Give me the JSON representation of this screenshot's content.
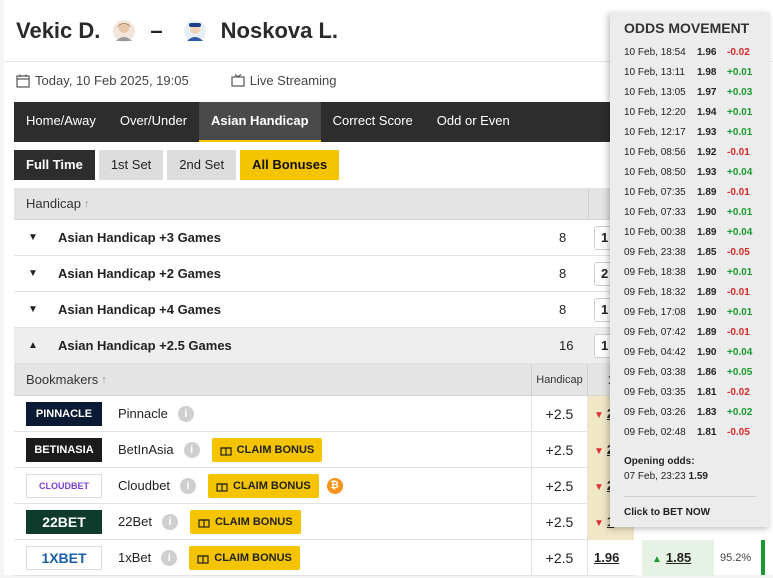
{
  "match": {
    "home": "Vekic D.",
    "separator": "–",
    "away": "Noskova L.",
    "date": "Today, 10 Feb 2025, 19:05",
    "streaming": "Live Streaming"
  },
  "market_tabs": [
    "Home/Away",
    "Over/Under",
    "Asian Handicap",
    "Correct Score",
    "Odd or Even"
  ],
  "market_tab_active": "Asian Handicap",
  "period_tabs": [
    "Full Time",
    "1st Set",
    "2nd Set",
    "All Bonuses"
  ],
  "handicap_table": {
    "header_label": "Handicap",
    "sort_icon": "arrow-up-icon",
    "col1": "1",
    "rows": [
      {
        "label": "Asian Handicap +3 Games",
        "count": "8",
        "odd": "1"
      },
      {
        "label": "Asian Handicap +2 Games",
        "count": "8",
        "odd": "2"
      },
      {
        "label": "Asian Handicap +4 Games",
        "count": "8",
        "odd": "1"
      },
      {
        "label": "Asian Handicap +2.5 Games",
        "count": "16",
        "odd": "1"
      }
    ]
  },
  "bookmakers_table": {
    "header_label": "Bookmakers",
    "handicap_label": "Handicap",
    "col1": "1",
    "claim_label": "CLAIM BONUS",
    "rows": [
      {
        "logo": "PINNACLE",
        "name": "Pinnacle",
        "handicap": "+2.5",
        "odd": "2",
        "bonus": false
      },
      {
        "logo": "BETINASIA",
        "name": "BetInAsia",
        "handicap": "+2.5",
        "odd": "2",
        "bonus": true
      },
      {
        "logo": "CLOUDBET",
        "name": "Cloudbet",
        "handicap": "+2.5",
        "odd": "2",
        "bonus": true
      },
      {
        "logo": "22BET",
        "name": "22Bet",
        "handicap": "+2.5",
        "odd": "1",
        "bonus": true
      },
      {
        "logo": "1XBET",
        "name": "1xBet",
        "handicap": "+2.5",
        "odd": "1.96",
        "odd2": "1.85",
        "payout": "95.2%",
        "bonus": true
      }
    ]
  },
  "odds_movement": {
    "title": "ODDS MOVEMENT",
    "rows": [
      {
        "time": "10 Feb, 18:54",
        "odd": "1.96",
        "delta": "-0.02"
      },
      {
        "time": "10 Feb, 13:11",
        "odd": "1.98",
        "delta": "+0.01"
      },
      {
        "time": "10 Feb, 13:05",
        "odd": "1.97",
        "delta": "+0.03"
      },
      {
        "time": "10 Feb, 12:20",
        "odd": "1.94",
        "delta": "+0.01"
      },
      {
        "time": "10 Feb, 12:17",
        "odd": "1.93",
        "delta": "+0.01"
      },
      {
        "time": "10 Feb, 08:56",
        "odd": "1.92",
        "delta": "-0.01"
      },
      {
        "time": "10 Feb, 08:50",
        "odd": "1.93",
        "delta": "+0.04"
      },
      {
        "time": "10 Feb, 07:35",
        "odd": "1.89",
        "delta": "-0.01"
      },
      {
        "time": "10 Feb, 07:33",
        "odd": "1.90",
        "delta": "+0.01"
      },
      {
        "time": "10 Feb, 00:38",
        "odd": "1.89",
        "delta": "+0.04"
      },
      {
        "time": "09 Feb, 23:38",
        "odd": "1.85",
        "delta": "-0.05"
      },
      {
        "time": "09 Feb, 18:38",
        "odd": "1.90",
        "delta": "+0.01"
      },
      {
        "time": "09 Feb, 18:32",
        "odd": "1.89",
        "delta": "-0.01"
      },
      {
        "time": "09 Feb, 17:08",
        "odd": "1.90",
        "delta": "+0.01"
      },
      {
        "time": "09 Feb, 07:42",
        "odd": "1.89",
        "delta": "-0.01"
      },
      {
        "time": "09 Feb, 04:42",
        "odd": "1.90",
        "delta": "+0.04"
      },
      {
        "time": "09 Feb, 03:38",
        "odd": "1.86",
        "delta": "+0.05"
      },
      {
        "time": "09 Feb, 03:35",
        "odd": "1.81",
        "delta": "-0.02"
      },
      {
        "time": "09 Feb, 03:26",
        "odd": "1.83",
        "delta": "+0.02"
      },
      {
        "time": "09 Feb, 02:48",
        "odd": "1.81",
        "delta": "-0.05"
      }
    ],
    "opening_label": "Opening odds:",
    "opening_time": "07 Feb, 23:23",
    "opening_odd": "1.59",
    "cta": "Click to BET NOW"
  },
  "colors": {
    "accent": "#f5c400",
    "dark": "#2d2d2d",
    "positive": "#1a9a2e",
    "negative": "#d32a2a"
  }
}
